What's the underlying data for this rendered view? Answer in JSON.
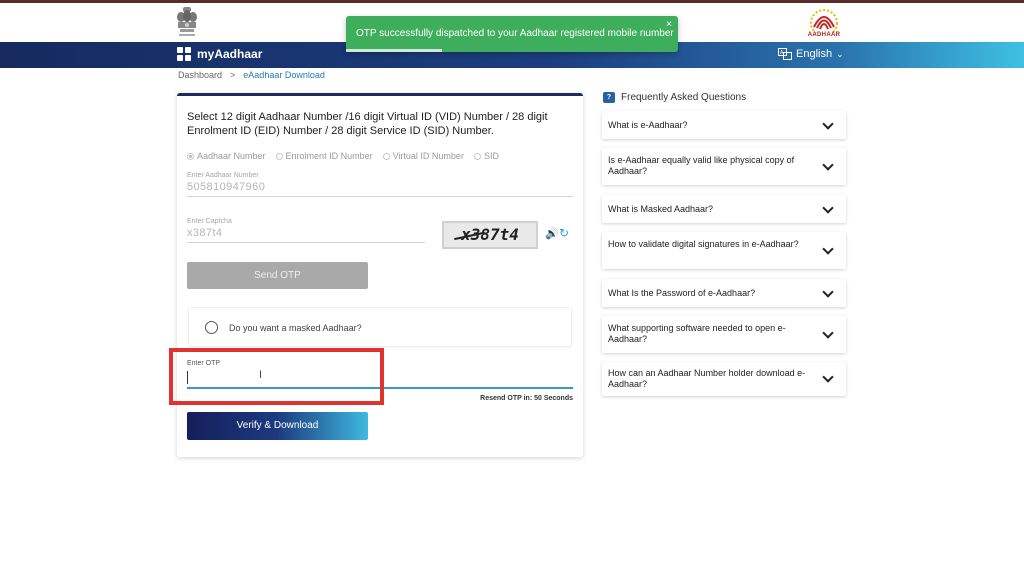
{
  "toast": {
    "message": "OTP successfully dispatched to your Aadhaar registered mobile number",
    "close": "×"
  },
  "header": {
    "brand": "myAadhaar",
    "language": "English",
    "logo_text": "AADHAAR"
  },
  "breadcrumb": {
    "home": "Dashboard",
    "separator": ">",
    "current": "eAadhaar Download"
  },
  "form": {
    "title": "Select 12 digit Aadhaar Number /16 digit Virtual ID (VID) Number / 28 digit Enrolment ID (EID) Number / 28 digit Service ID (SID) Number.",
    "options": [
      "Aadhaar Number",
      "Enrolment ID Number",
      "Virtual ID Number",
      "SID"
    ],
    "selected_option": "Aadhaar Number",
    "aadhaar_label": "Enter Aadhaar Number",
    "aadhaar_value": "505810947960",
    "captcha_label": "Enter Captcha",
    "captcha_value": "x387t4",
    "captcha_image_text": "x387t4",
    "send_otp": "Send OTP",
    "masked_question": "Do you want a masked Aadhaar?",
    "otp_label": "Enter OTP",
    "resend_text": "Resend OTP in: 50 Seconds",
    "verify_button": "Verify & Download"
  },
  "faq": {
    "heading": "Frequently Asked Questions",
    "items": [
      "What is e-Aadhaar?",
      "Is e-Aadhaar equally valid like physical copy of Aadhaar?",
      "What is Masked Aadhaar?",
      "How to validate digital signatures in e-Aadhaar?",
      "What Is the Password of e-Aadhaar?",
      "What supporting software needed to open e-Aadhaar?",
      "How can an Aadhaar Number holder download e-Aadhaar?"
    ]
  },
  "colors": {
    "navbar_start": "#162a5e",
    "navbar_end": "#3ec0e2",
    "toast": "#3fae5c",
    "highlight": "#e0332e",
    "otp_underline": "#3a98c9"
  }
}
